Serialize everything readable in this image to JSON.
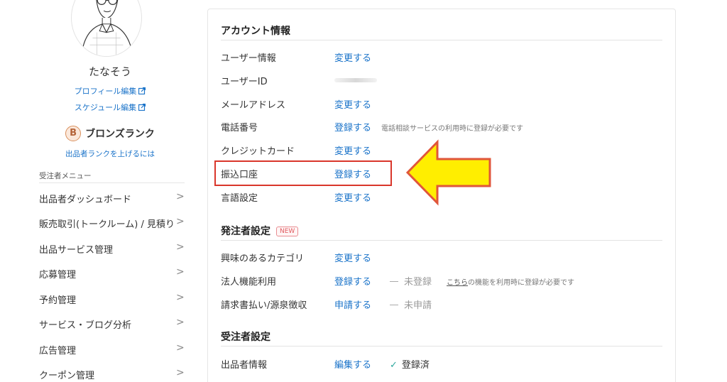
{
  "sidebar": {
    "user_name": "たなそう",
    "profile_edit": "プロフィール編集",
    "schedule_edit": "スケジュール編集",
    "rank_letter": "B",
    "rank_name": "ブロンズランク",
    "rank_up_link": "出品者ランクを上げるには",
    "menu_title": "受注者メニュー",
    "menu_items": [
      {
        "label": "出品者ダッシュボード"
      },
      {
        "label": "販売取引(トークルーム) / 見積り"
      },
      {
        "label": "出品サービス管理"
      },
      {
        "label": "応募管理"
      },
      {
        "label": "予約管理"
      },
      {
        "label": "サービス・ブログ分析"
      },
      {
        "label": "広告管理"
      },
      {
        "label": "クーポン管理"
      }
    ],
    "chevron": ">"
  },
  "account": {
    "title": "アカウント情報",
    "rows": [
      {
        "label": "ユーザー情報",
        "action": "変更する"
      },
      {
        "label": "ユーザーID",
        "action": ""
      },
      {
        "label": "メールアドレス",
        "action": "変更する"
      },
      {
        "label": "電話番号",
        "action": "登録する",
        "note": "電話相談サービスの利用時に登録が必要です"
      },
      {
        "label": "クレジットカード",
        "action": "変更する"
      },
      {
        "label": "振込口座",
        "action": "登録する"
      },
      {
        "label": "言語設定",
        "action": "変更する"
      }
    ]
  },
  "orderer": {
    "title": "発注者設定",
    "new_badge": "NEW",
    "rows": [
      {
        "label": "興味のあるカテゴリ",
        "action": "変更する"
      },
      {
        "label": "法人機能利用",
        "action": "登録する",
        "status": "未登録",
        "note_link": "こちら",
        "note": "の機能を利用時に登録が必要です"
      },
      {
        "label": "請求書払い/源泉徴収",
        "action": "申請する",
        "status": "未申請"
      }
    ]
  },
  "contractor": {
    "title": "受注者設定",
    "rows": [
      {
        "label": "出品者情報",
        "action": "編集する",
        "status": "登録済"
      }
    ]
  },
  "colors": {
    "link": "#1a73c9",
    "highlight_border": "#d9362b",
    "arrow_fill": "#ffee00",
    "arrow_stroke": "#e0563a",
    "check": "#2fa89e"
  },
  "icons": [
    "external-link-icon",
    "chevron-right-icon",
    "check-icon",
    "bronze-rank-badge-icon",
    "avatar-illustration"
  ]
}
